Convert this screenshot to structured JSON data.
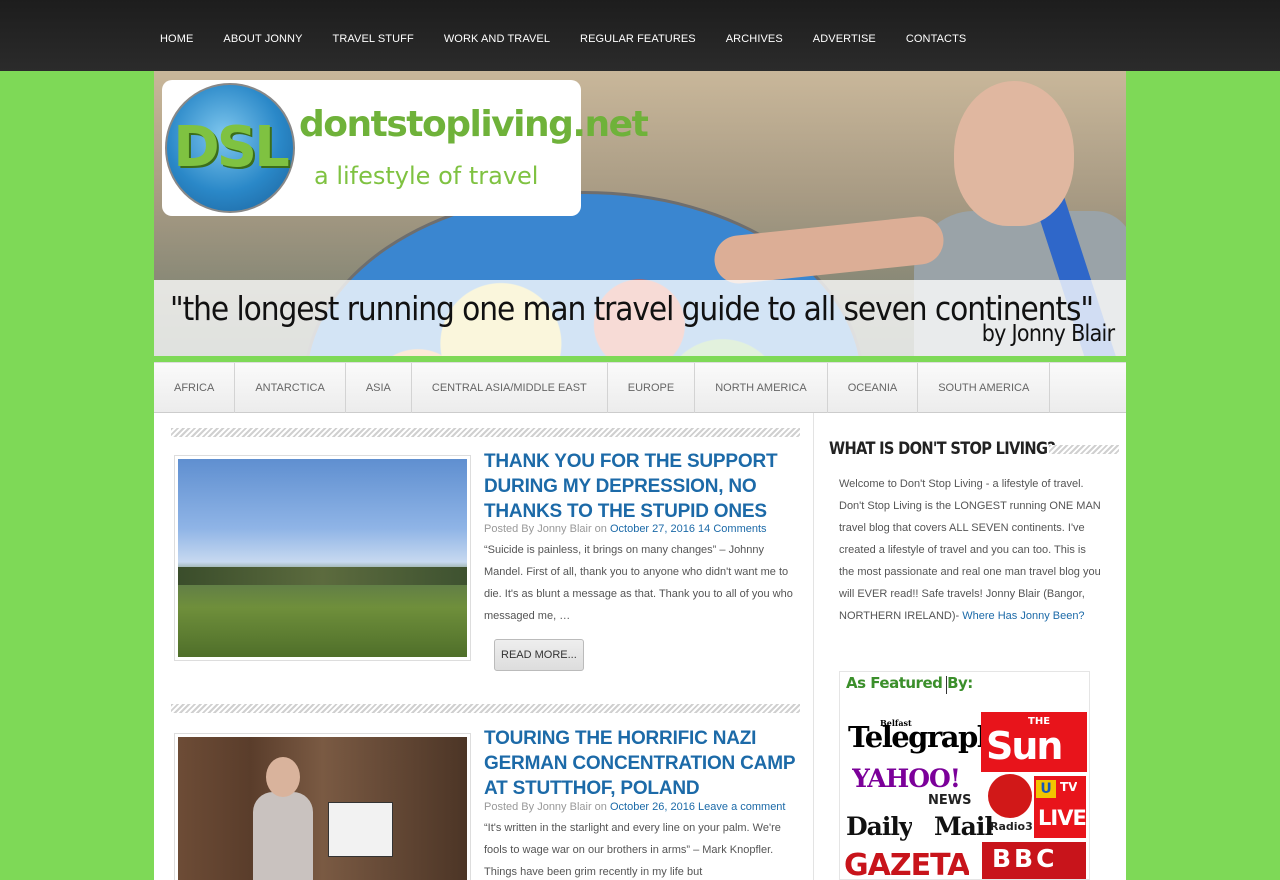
{
  "top_nav": {
    "items": [
      "HOME",
      "ABOUT JONNY",
      "TRAVEL STUFF",
      "WORK AND TRAVEL",
      "REGULAR FEATURES",
      "ARCHIVES",
      "ADVERTISE",
      "CONTACTS"
    ]
  },
  "header": {
    "logo_mark": "DSL",
    "site_name": "dontstopliving.net",
    "site_tagline": "a lifestyle of travel",
    "quote": "\"the longest running one man travel guide to all seven continents\"",
    "byline": "by Jonny Blair"
  },
  "region_nav": {
    "items": [
      "AFRICA",
      "ANTARCTICA",
      "ASIA",
      "CENTRAL ASIA/MIDDLE EAST",
      "EUROPE",
      "NORTH AMERICA",
      "OCEANIA",
      "SOUTH AMERICA"
    ]
  },
  "posts": [
    {
      "title": "THANK YOU FOR THE SUPPORT DURING MY DEPRESSION, NO THANKS TO THE STUPID ONES",
      "meta_prefix": "Posted By Jonny Blair on",
      "date": "October 27, 2016",
      "comments": "14 Comments",
      "excerpt": "“Suicide is painless, it brings on many changes” – Johnny Mandel.  First of all, thank you to anyone who didn't want me to die. It's as blunt a message as that. Thank you to all of you who messaged me, …",
      "read_more": "READ MORE..."
    },
    {
      "title": "TOURING THE HORRIFIC NAZI GERMAN CONCENTRATION CAMP AT STUTTHOF, POLAND",
      "meta_prefix": "Posted By Jonny Blair on",
      "date": "October 26, 2016",
      "comments": "Leave a comment",
      "excerpt": "“It's written in the starlight and every line on your palm. We're fools to wage war on our brothers in arms” – Mark Knopfler. Things have been grim recently in my life but"
    }
  ],
  "sidebar": {
    "widget_title": "WHAT IS DON'T STOP LIVING?",
    "intro_text": "Welcome to Don't Stop Living - a lifestyle of travel. Don't Stop Living is the LONGEST running ONE MAN travel blog that covers ALL SEVEN continents. I've created a lifestyle of travel and you can too. This is the most passionate and real one man travel blog you will EVER read!! Safe travels! Jonny Blair (Bangor, NORTHERN IRELAND)-",
    "intro_link": "Where Has Jonny Been?",
    "featured_title": "As Featured By:",
    "featured_logos": [
      "Belfast",
      "Telegraph",
      "THE",
      "Sun",
      "YAHOO!",
      "NEWS",
      "U",
      "TV",
      "LIVE",
      "Radio3",
      "Daily",
      "Mail",
      "GAZETA",
      "BBC"
    ]
  },
  "colors": {
    "page_bg": "#7ed957",
    "nav_bg": "#1d1d1d",
    "link_blue": "#1c6aa8",
    "brand_green": "#7fc241"
  }
}
